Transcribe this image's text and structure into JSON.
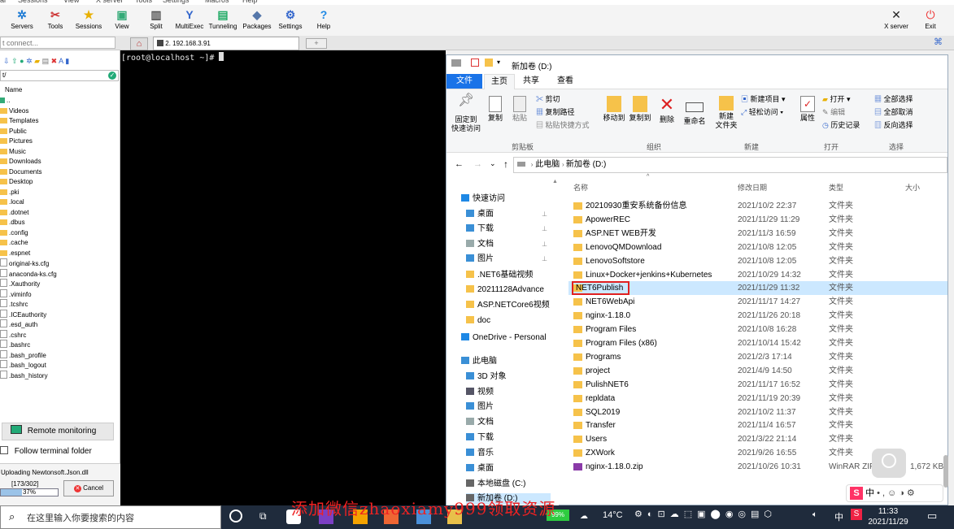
{
  "menubar": [
    "al",
    "Sessions",
    "View",
    "X server",
    "Tools",
    "Settings",
    "Macros",
    "Help"
  ],
  "toolbar": {
    "left": [
      {
        "label": "Servers",
        "icon": "servers-icon",
        "glyph": "✲",
        "color": "#1e7bd4"
      },
      {
        "label": "Tools",
        "icon": "tools-icon",
        "glyph": "✂",
        "color": "#c33"
      },
      {
        "label": "Sessions",
        "icon": "sessions-icon",
        "glyph": "★",
        "color": "#e8b000"
      },
      {
        "label": "View",
        "icon": "view-icon",
        "glyph": "▣",
        "color": "#3a7"
      },
      {
        "label": "Split",
        "icon": "split-icon",
        "glyph": "▥",
        "color": "#555"
      },
      {
        "label": "MultiExec",
        "icon": "multiexec-icon",
        "glyph": "Y",
        "color": "#36c"
      },
      {
        "label": "Tunneling",
        "icon": "tunneling-icon",
        "glyph": "▤",
        "color": "#2a6"
      },
      {
        "label": "Packages",
        "icon": "packages-icon",
        "glyph": "◆",
        "color": "#57a"
      },
      {
        "label": "Settings",
        "icon": "settings-icon",
        "glyph": "⚙",
        "color": "#36c"
      },
      {
        "label": "Help",
        "icon": "help-icon",
        "glyph": "?",
        "color": "#1e88e5"
      }
    ],
    "xserver": "X server",
    "exit": "Exit"
  },
  "quick_connect": "t connect...",
  "tab": {
    "num": "2",
    "host": "192.168.3.91"
  },
  "sftp": {
    "path": "t/",
    "column": "Name",
    "items": [
      {
        "name": "..",
        "type": "up"
      },
      {
        "name": "Videos",
        "type": "folder"
      },
      {
        "name": "Templates",
        "type": "folder"
      },
      {
        "name": "Public",
        "type": "folder"
      },
      {
        "name": "Pictures",
        "type": "folder"
      },
      {
        "name": "Music",
        "type": "folder"
      },
      {
        "name": "Downloads",
        "type": "folder"
      },
      {
        "name": "Documents",
        "type": "folder"
      },
      {
        "name": "Desktop",
        "type": "folder"
      },
      {
        "name": ".pki",
        "type": "folder"
      },
      {
        "name": ".local",
        "type": "folder"
      },
      {
        "name": ".dotnet",
        "type": "folder"
      },
      {
        "name": ".dbus",
        "type": "folder"
      },
      {
        "name": ".config",
        "type": "folder"
      },
      {
        "name": ".cache",
        "type": "folder"
      },
      {
        "name": ".espnet",
        "type": "folder"
      },
      {
        "name": "original-ks.cfg",
        "type": "file"
      },
      {
        "name": "anaconda-ks.cfg",
        "type": "file"
      },
      {
        "name": ".Xauthority",
        "type": "file"
      },
      {
        "name": ".viminfo",
        "type": "file"
      },
      {
        "name": ".tcshrc",
        "type": "file"
      },
      {
        "name": ".ICEauthority",
        "type": "file"
      },
      {
        "name": ".esd_auth",
        "type": "file"
      },
      {
        "name": ".cshrc",
        "type": "file"
      },
      {
        "name": ".bashrc",
        "type": "file"
      },
      {
        "name": ".bash_profile",
        "type": "file"
      },
      {
        "name": ".bash_logout",
        "type": "file"
      },
      {
        "name": ".bash_history",
        "type": "file"
      }
    ],
    "remote_monitoring": "Remote monitoring",
    "follow_folder": "Follow terminal folder",
    "upload_label": "Uploading Newtonsoft.Json.dll",
    "upload_count": "[173/302]",
    "upload_percent": "37%",
    "upload_progress": 0.37,
    "cancel": "Cancel"
  },
  "terminal": {
    "prompt": "[root@localhost ~]# "
  },
  "explorer": {
    "title": "新加卷 (D:)",
    "tabs": [
      "文件",
      "主页",
      "共享",
      "查看"
    ],
    "ribbon": {
      "pin": "固定到\n快速访问",
      "copy": "复制",
      "paste": "粘贴",
      "cut": "剪切",
      "copy_path": "复制路径",
      "paste_shortcut": "粘贴快捷方式",
      "move_to": "移动到",
      "copy_to": "复制到",
      "delete": "删除",
      "rename": "重命名",
      "new_folder": "新建\n文件夹",
      "new_item": "新建项目",
      "easy_access": "轻松访问",
      "properties": "属性",
      "open": "打开",
      "edit": "编辑",
      "history": "历史记录",
      "select_all": "全部选择",
      "select_none": "全部取消",
      "invert": "反向选择",
      "groups": [
        "剪贴板",
        "组织",
        "新建",
        "打开",
        "选择"
      ]
    },
    "breadcrumb": [
      "此电脑",
      "新加卷 (D:)"
    ],
    "nav": [
      {
        "label": "快速访问",
        "icon": "star-icon",
        "color": "#1e88e5",
        "indent": 0
      },
      {
        "label": "桌面",
        "icon": "desktop-icon",
        "color": "#3a8fd6",
        "indent": 1,
        "pin": true
      },
      {
        "label": "下载",
        "icon": "download-icon",
        "color": "#3a8fd6",
        "indent": 1,
        "pin": true
      },
      {
        "label": "文档",
        "icon": "document-icon",
        "color": "#9aa",
        "indent": 1,
        "pin": true
      },
      {
        "label": "图片",
        "icon": "picture-icon",
        "color": "#3a8fd6",
        "indent": 1,
        "pin": true
      },
      {
        "label": ".NET6基础视频",
        "icon": "folder-icon",
        "color": "#f6c24a",
        "indent": 1
      },
      {
        "label": "20211128Advance",
        "icon": "folder-icon",
        "color": "#f6c24a",
        "indent": 1
      },
      {
        "label": "ASP.NETCore6视频",
        "icon": "folder-icon",
        "color": "#f6c24a",
        "indent": 1
      },
      {
        "label": "doc",
        "icon": "folder-icon",
        "color": "#f6c24a",
        "indent": 1
      },
      {
        "label": "OneDrive - Personal",
        "icon": "cloud-icon",
        "color": "#1e88e5",
        "indent": 0
      },
      {
        "label": "此电脑",
        "icon": "computer-icon",
        "color": "#3a8fd6",
        "indent": 0
      },
      {
        "label": "3D 对象",
        "icon": "cube-icon",
        "color": "#3a8fd6",
        "indent": 1
      },
      {
        "label": "视频",
        "icon": "video-icon",
        "color": "#556",
        "indent": 1
      },
      {
        "label": "图片",
        "icon": "picture-icon",
        "color": "#3a8fd6",
        "indent": 1
      },
      {
        "label": "文档",
        "icon": "document-icon",
        "color": "#9aa",
        "indent": 1
      },
      {
        "label": "下载",
        "icon": "download-icon",
        "color": "#3a8fd6",
        "indent": 1
      },
      {
        "label": "音乐",
        "icon": "music-icon",
        "color": "#3a8fd6",
        "indent": 1
      },
      {
        "label": "桌面",
        "icon": "desktop-icon",
        "color": "#3a8fd6",
        "indent": 1
      },
      {
        "label": "本地磁盘 (C:)",
        "icon": "drive-icon",
        "color": "#666",
        "indent": 1
      },
      {
        "label": "新加卷 (D:)",
        "icon": "drive-icon",
        "color": "#666",
        "indent": 1,
        "selected": true
      }
    ],
    "columns": [
      "名称",
      "修改日期",
      "类型",
      "大小"
    ],
    "rows": [
      {
        "name": "20210930重安系统备份信息",
        "date": "2021/10/2 22:37",
        "type": "文件夹",
        "size": ""
      },
      {
        "name": "ApowerREC",
        "date": "2021/11/29 11:29",
        "type": "文件夹",
        "size": ""
      },
      {
        "name": "ASP.NET WEB开发",
        "date": "2021/11/3 16:59",
        "type": "文件夹",
        "size": ""
      },
      {
        "name": "LenovoQMDownload",
        "date": "2021/10/8 12:05",
        "type": "文件夹",
        "size": ""
      },
      {
        "name": "LenovoSoftstore",
        "date": "2021/10/8 12:05",
        "type": "文件夹",
        "size": ""
      },
      {
        "name": "Linux+Docker+jenkins+Kubernetes",
        "date": "2021/10/29 14:32",
        "type": "文件夹",
        "size": ""
      },
      {
        "name": "NET6Publish",
        "date": "2021/11/29 11:32",
        "type": "文件夹",
        "size": "",
        "selected": true
      },
      {
        "name": "NET6WebApi",
        "date": "2021/11/17 14:27",
        "type": "文件夹",
        "size": ""
      },
      {
        "name": "nginx-1.18.0",
        "date": "2021/11/26 20:18",
        "type": "文件夹",
        "size": ""
      },
      {
        "name": "Program Files",
        "date": "2021/10/8 16:28",
        "type": "文件夹",
        "size": ""
      },
      {
        "name": "Program Files (x86)",
        "date": "2021/10/14 15:42",
        "type": "文件夹",
        "size": ""
      },
      {
        "name": "Programs",
        "date": "2021/2/3 17:14",
        "type": "文件夹",
        "size": ""
      },
      {
        "name": "project",
        "date": "2021/4/9 14:50",
        "type": "文件夹",
        "size": ""
      },
      {
        "name": "PulishNET6",
        "date": "2021/11/17 16:52",
        "type": "文件夹",
        "size": ""
      },
      {
        "name": "repldata",
        "date": "2021/11/19 20:39",
        "type": "文件夹",
        "size": ""
      },
      {
        "name": "SQL2019",
        "date": "2021/10/2 11:37",
        "type": "文件夹",
        "size": ""
      },
      {
        "name": "Transfer",
        "date": "2021/11/4 16:57",
        "type": "文件夹",
        "size": ""
      },
      {
        "name": "Users",
        "date": "2021/3/22 21:14",
        "type": "文件夹",
        "size": ""
      },
      {
        "name": "ZXWork",
        "date": "2021/9/26 16:55",
        "type": "文件夹",
        "size": ""
      },
      {
        "name": "nginx-1.18.0.zip",
        "date": "2021/10/26 10:31",
        "type": "WinRAR ZIP",
        "size": "1,672 KB",
        "zip": true
      }
    ]
  },
  "taskbar": {
    "search_placeholder": "在这里输入你要搜索的内容",
    "battery": "99%",
    "temperature": "14°C",
    "ime": "中",
    "time": "11:33",
    "date": "2021/11/29"
  },
  "watermark": "添加微信zhaoxiamy999领取资源",
  "colors": {
    "selection": "#cce8ff",
    "highlight_box": "#e02020",
    "terminal_bg": "#000000"
  }
}
